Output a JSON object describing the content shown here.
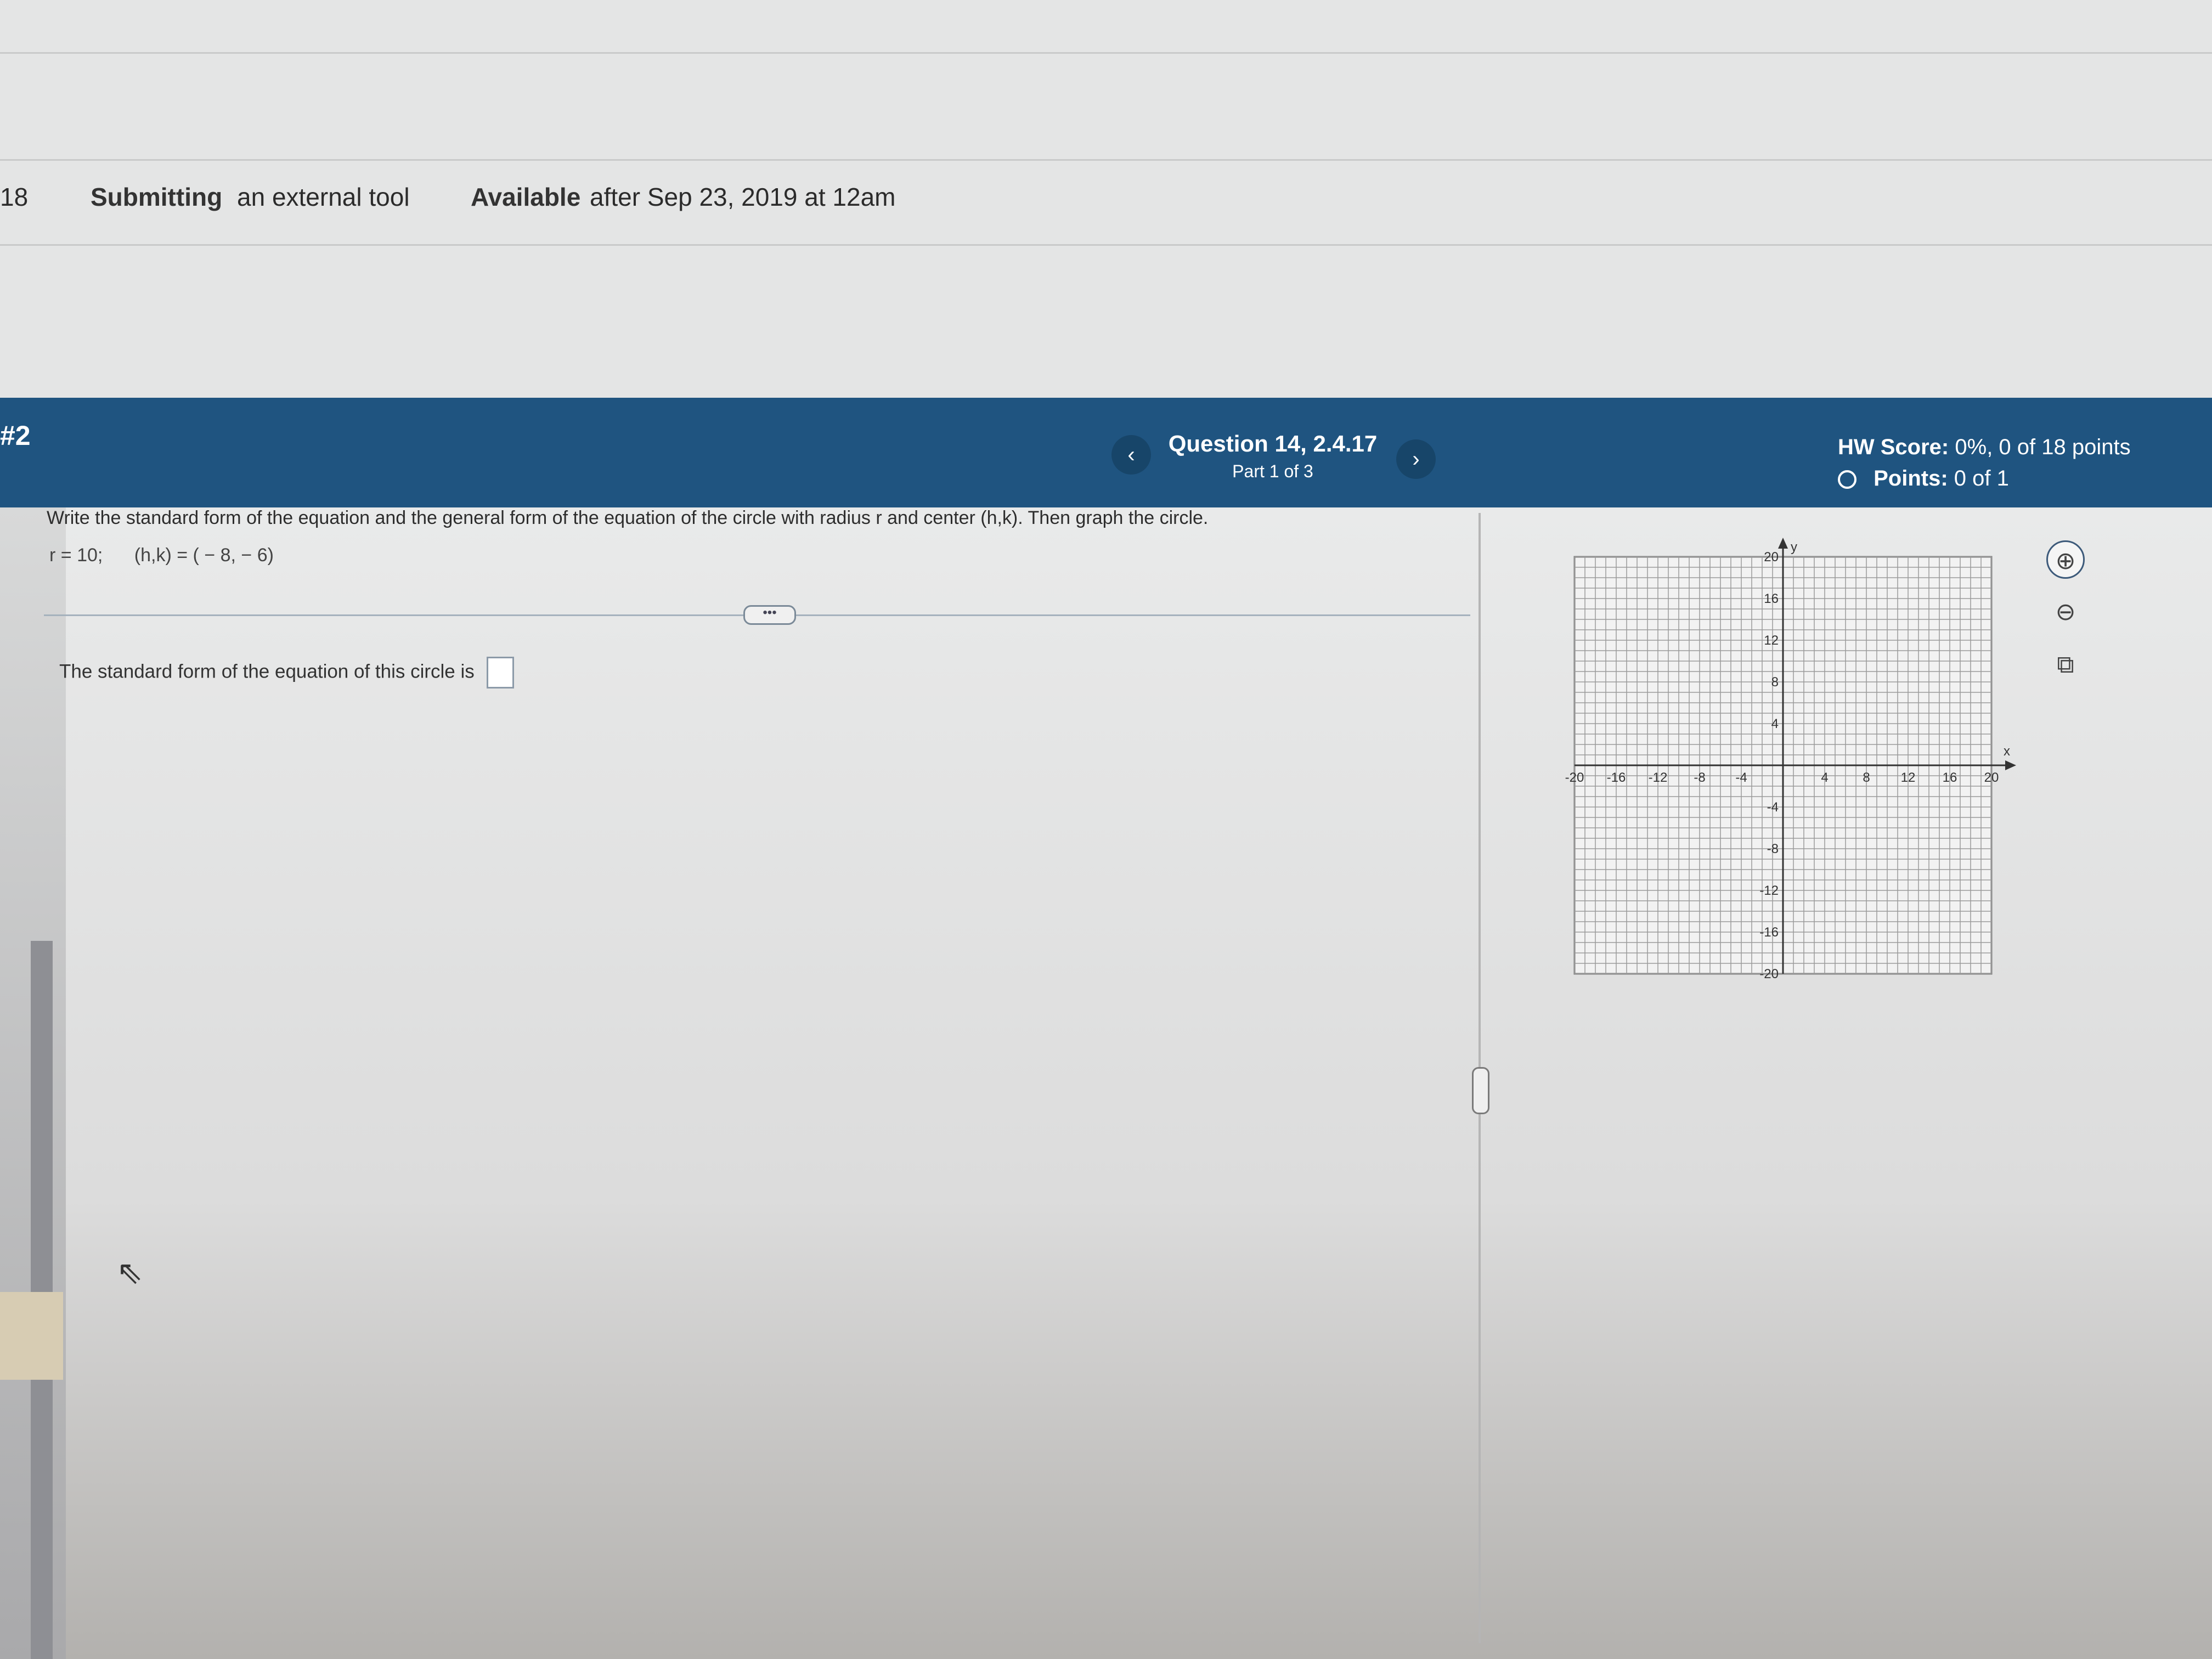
{
  "header": {
    "left_number": "18",
    "submitting_label": "Submitting",
    "submitting_value": "an external tool",
    "available_label": "Available",
    "available_value": "after Sep 23, 2019 at 12am"
  },
  "banner": {
    "number": "#2",
    "prev_symbol": "‹",
    "next_symbol": "›",
    "question_title": "Question 14, 2.4.17",
    "part": "Part 1 of 3",
    "hw_score_label": "HW Score:",
    "hw_score_value": "0%, 0 of 18 points",
    "points_label": "Points:",
    "points_value": "0 of 1"
  },
  "question": {
    "prompt": "Write the standard form of the equation and the general form of the equation of the circle with radius r and center (h,k). Then graph the circle.",
    "radius": "r = 10;",
    "center": "(h,k) = ( − 8, − 6)",
    "more_label": "•••",
    "answer_prefix": "The standard form of the equation of this circle is"
  },
  "tools": {
    "zoom_in_icon": "zoom-in-icon",
    "zoom_out_icon": "zoom-out-icon",
    "popout_icon": "popout-icon"
  },
  "chart_data": {
    "type": "scatter",
    "title": "",
    "xlabel": "x",
    "ylabel": "y",
    "xlim": [
      -20,
      20
    ],
    "ylim": [
      -20,
      20
    ],
    "grid": true,
    "x_ticks": [
      -20,
      -16,
      -12,
      -8,
      -4,
      4,
      8,
      12,
      16,
      20
    ],
    "y_ticks": [
      20,
      16,
      12,
      8,
      4,
      -4,
      -8,
      -12,
      -16,
      -20
    ],
    "series": []
  }
}
